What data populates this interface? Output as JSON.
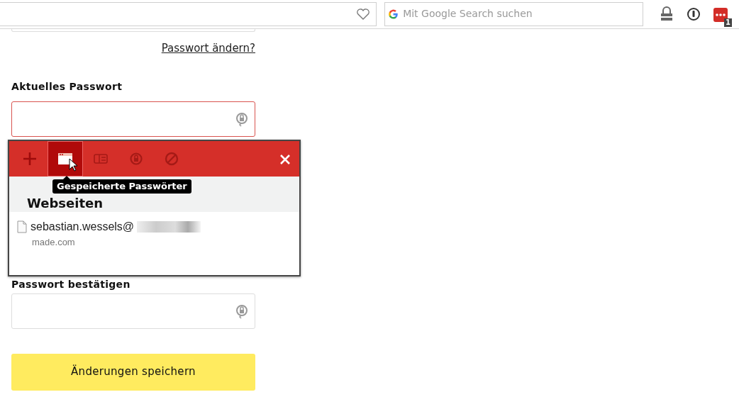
{
  "browser_toolbar": {
    "search": {
      "placeholder": "Mit Google Search suchen"
    },
    "extension_badge": "1"
  },
  "form": {
    "change_password_link": "Passwort ändern?",
    "fields": [
      {
        "label": "Aktuelles Passwort",
        "error": true
      },
      {
        "label": "Passwort bestätigen",
        "error": false
      }
    ],
    "submit_button": "Änderungen speichern"
  },
  "password_popup": {
    "tabs": [
      {
        "kind": "add",
        "selected": false
      },
      {
        "kind": "passwords",
        "selected": true
      },
      {
        "kind": "cards",
        "selected": false
      },
      {
        "kind": "generator",
        "selected": false
      },
      {
        "kind": "never",
        "selected": false
      }
    ],
    "tooltip": "Gespeicherte Passwörter",
    "section_title": "Webseiten",
    "entries": [
      {
        "username": "sebastian.wessels@",
        "site": "made.com"
      }
    ]
  }
}
